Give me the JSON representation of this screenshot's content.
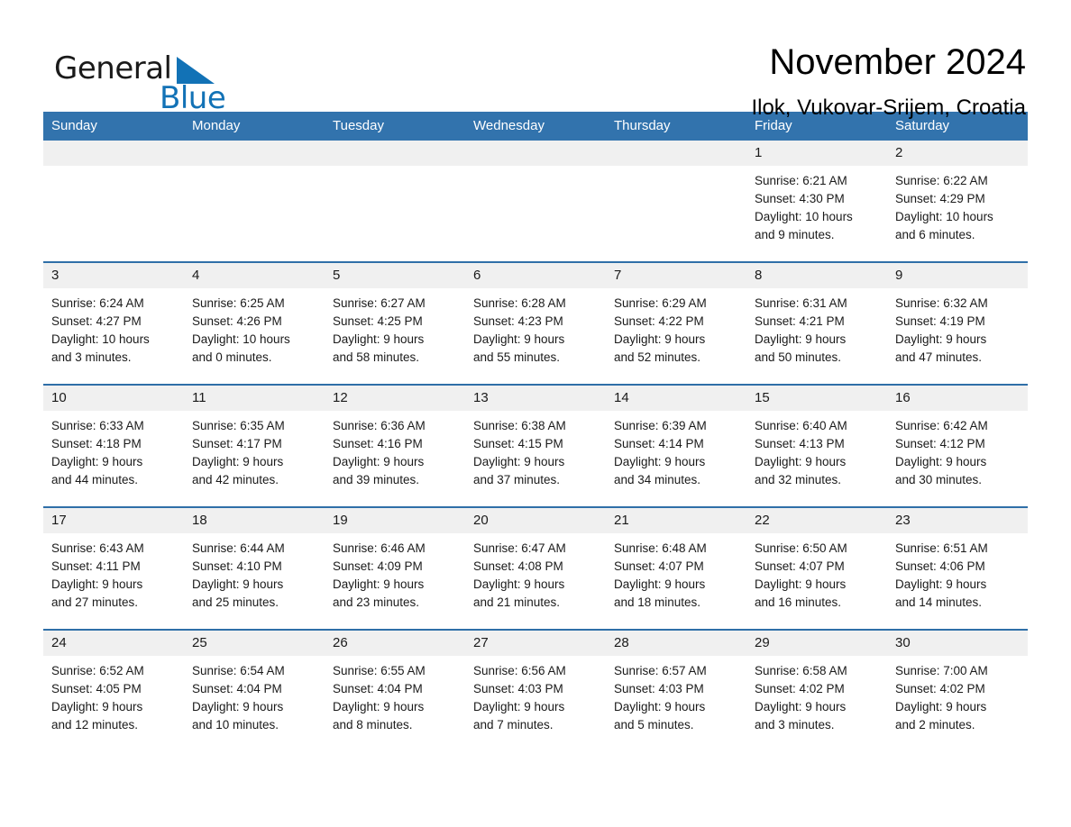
{
  "brand": {
    "name_part1": "General",
    "name_part2": "Blue",
    "flag_icon": "triangle-flag-icon",
    "accent_color": "#1272b6"
  },
  "header": {
    "month_title": "November 2024",
    "location": "Ilok, Vukovar-Srijem, Croatia"
  },
  "theme": {
    "header_bg": "#3273ad",
    "row_divider": "#2f6fa8",
    "daynum_bg": "#f0f0f0"
  },
  "weekday_headers": [
    "Sunday",
    "Monday",
    "Tuesday",
    "Wednesday",
    "Thursday",
    "Friday",
    "Saturday"
  ],
  "weeks": [
    [
      {
        "day": "",
        "blank": true
      },
      {
        "day": "",
        "blank": true
      },
      {
        "day": "",
        "blank": true
      },
      {
        "day": "",
        "blank": true
      },
      {
        "day": "",
        "blank": true
      },
      {
        "day": "1",
        "sunrise": "Sunrise: 6:21 AM",
        "sunset": "Sunset: 4:30 PM",
        "daylight_line1": "Daylight: 10 hours",
        "daylight_line2": "and 9 minutes."
      },
      {
        "day": "2",
        "sunrise": "Sunrise: 6:22 AM",
        "sunset": "Sunset: 4:29 PM",
        "daylight_line1": "Daylight: 10 hours",
        "daylight_line2": "and 6 minutes."
      }
    ],
    [
      {
        "day": "3",
        "sunrise": "Sunrise: 6:24 AM",
        "sunset": "Sunset: 4:27 PM",
        "daylight_line1": "Daylight: 10 hours",
        "daylight_line2": "and 3 minutes."
      },
      {
        "day": "4",
        "sunrise": "Sunrise: 6:25 AM",
        "sunset": "Sunset: 4:26 PM",
        "daylight_line1": "Daylight: 10 hours",
        "daylight_line2": "and 0 minutes."
      },
      {
        "day": "5",
        "sunrise": "Sunrise: 6:27 AM",
        "sunset": "Sunset: 4:25 PM",
        "daylight_line1": "Daylight: 9 hours",
        "daylight_line2": "and 58 minutes."
      },
      {
        "day": "6",
        "sunrise": "Sunrise: 6:28 AM",
        "sunset": "Sunset: 4:23 PM",
        "daylight_line1": "Daylight: 9 hours",
        "daylight_line2": "and 55 minutes."
      },
      {
        "day": "7",
        "sunrise": "Sunrise: 6:29 AM",
        "sunset": "Sunset: 4:22 PM",
        "daylight_line1": "Daylight: 9 hours",
        "daylight_line2": "and 52 minutes."
      },
      {
        "day": "8",
        "sunrise": "Sunrise: 6:31 AM",
        "sunset": "Sunset: 4:21 PM",
        "daylight_line1": "Daylight: 9 hours",
        "daylight_line2": "and 50 minutes."
      },
      {
        "day": "9",
        "sunrise": "Sunrise: 6:32 AM",
        "sunset": "Sunset: 4:19 PM",
        "daylight_line1": "Daylight: 9 hours",
        "daylight_line2": "and 47 minutes."
      }
    ],
    [
      {
        "day": "10",
        "sunrise": "Sunrise: 6:33 AM",
        "sunset": "Sunset: 4:18 PM",
        "daylight_line1": "Daylight: 9 hours",
        "daylight_line2": "and 44 minutes."
      },
      {
        "day": "11",
        "sunrise": "Sunrise: 6:35 AM",
        "sunset": "Sunset: 4:17 PM",
        "daylight_line1": "Daylight: 9 hours",
        "daylight_line2": "and 42 minutes."
      },
      {
        "day": "12",
        "sunrise": "Sunrise: 6:36 AM",
        "sunset": "Sunset: 4:16 PM",
        "daylight_line1": "Daylight: 9 hours",
        "daylight_line2": "and 39 minutes."
      },
      {
        "day": "13",
        "sunrise": "Sunrise: 6:38 AM",
        "sunset": "Sunset: 4:15 PM",
        "daylight_line1": "Daylight: 9 hours",
        "daylight_line2": "and 37 minutes."
      },
      {
        "day": "14",
        "sunrise": "Sunrise: 6:39 AM",
        "sunset": "Sunset: 4:14 PM",
        "daylight_line1": "Daylight: 9 hours",
        "daylight_line2": "and 34 minutes."
      },
      {
        "day": "15",
        "sunrise": "Sunrise: 6:40 AM",
        "sunset": "Sunset: 4:13 PM",
        "daylight_line1": "Daylight: 9 hours",
        "daylight_line2": "and 32 minutes."
      },
      {
        "day": "16",
        "sunrise": "Sunrise: 6:42 AM",
        "sunset": "Sunset: 4:12 PM",
        "daylight_line1": "Daylight: 9 hours",
        "daylight_line2": "and 30 minutes."
      }
    ],
    [
      {
        "day": "17",
        "sunrise": "Sunrise: 6:43 AM",
        "sunset": "Sunset: 4:11 PM",
        "daylight_line1": "Daylight: 9 hours",
        "daylight_line2": "and 27 minutes."
      },
      {
        "day": "18",
        "sunrise": "Sunrise: 6:44 AM",
        "sunset": "Sunset: 4:10 PM",
        "daylight_line1": "Daylight: 9 hours",
        "daylight_line2": "and 25 minutes."
      },
      {
        "day": "19",
        "sunrise": "Sunrise: 6:46 AM",
        "sunset": "Sunset: 4:09 PM",
        "daylight_line1": "Daylight: 9 hours",
        "daylight_line2": "and 23 minutes."
      },
      {
        "day": "20",
        "sunrise": "Sunrise: 6:47 AM",
        "sunset": "Sunset: 4:08 PM",
        "daylight_line1": "Daylight: 9 hours",
        "daylight_line2": "and 21 minutes."
      },
      {
        "day": "21",
        "sunrise": "Sunrise: 6:48 AM",
        "sunset": "Sunset: 4:07 PM",
        "daylight_line1": "Daylight: 9 hours",
        "daylight_line2": "and 18 minutes."
      },
      {
        "day": "22",
        "sunrise": "Sunrise: 6:50 AM",
        "sunset": "Sunset: 4:07 PM",
        "daylight_line1": "Daylight: 9 hours",
        "daylight_line2": "and 16 minutes."
      },
      {
        "day": "23",
        "sunrise": "Sunrise: 6:51 AM",
        "sunset": "Sunset: 4:06 PM",
        "daylight_line1": "Daylight: 9 hours",
        "daylight_line2": "and 14 minutes."
      }
    ],
    [
      {
        "day": "24",
        "sunrise": "Sunrise: 6:52 AM",
        "sunset": "Sunset: 4:05 PM",
        "daylight_line1": "Daylight: 9 hours",
        "daylight_line2": "and 12 minutes."
      },
      {
        "day": "25",
        "sunrise": "Sunrise: 6:54 AM",
        "sunset": "Sunset: 4:04 PM",
        "daylight_line1": "Daylight: 9 hours",
        "daylight_line2": "and 10 minutes."
      },
      {
        "day": "26",
        "sunrise": "Sunrise: 6:55 AM",
        "sunset": "Sunset: 4:04 PM",
        "daylight_line1": "Daylight: 9 hours",
        "daylight_line2": "and 8 minutes."
      },
      {
        "day": "27",
        "sunrise": "Sunrise: 6:56 AM",
        "sunset": "Sunset: 4:03 PM",
        "daylight_line1": "Daylight: 9 hours",
        "daylight_line2": "and 7 minutes."
      },
      {
        "day": "28",
        "sunrise": "Sunrise: 6:57 AM",
        "sunset": "Sunset: 4:03 PM",
        "daylight_line1": "Daylight: 9 hours",
        "daylight_line2": "and 5 minutes."
      },
      {
        "day": "29",
        "sunrise": "Sunrise: 6:58 AM",
        "sunset": "Sunset: 4:02 PM",
        "daylight_line1": "Daylight: 9 hours",
        "daylight_line2": "and 3 minutes."
      },
      {
        "day": "30",
        "sunrise": "Sunrise: 7:00 AM",
        "sunset": "Sunset: 4:02 PM",
        "daylight_line1": "Daylight: 9 hours",
        "daylight_line2": "and 2 minutes."
      }
    ]
  ]
}
